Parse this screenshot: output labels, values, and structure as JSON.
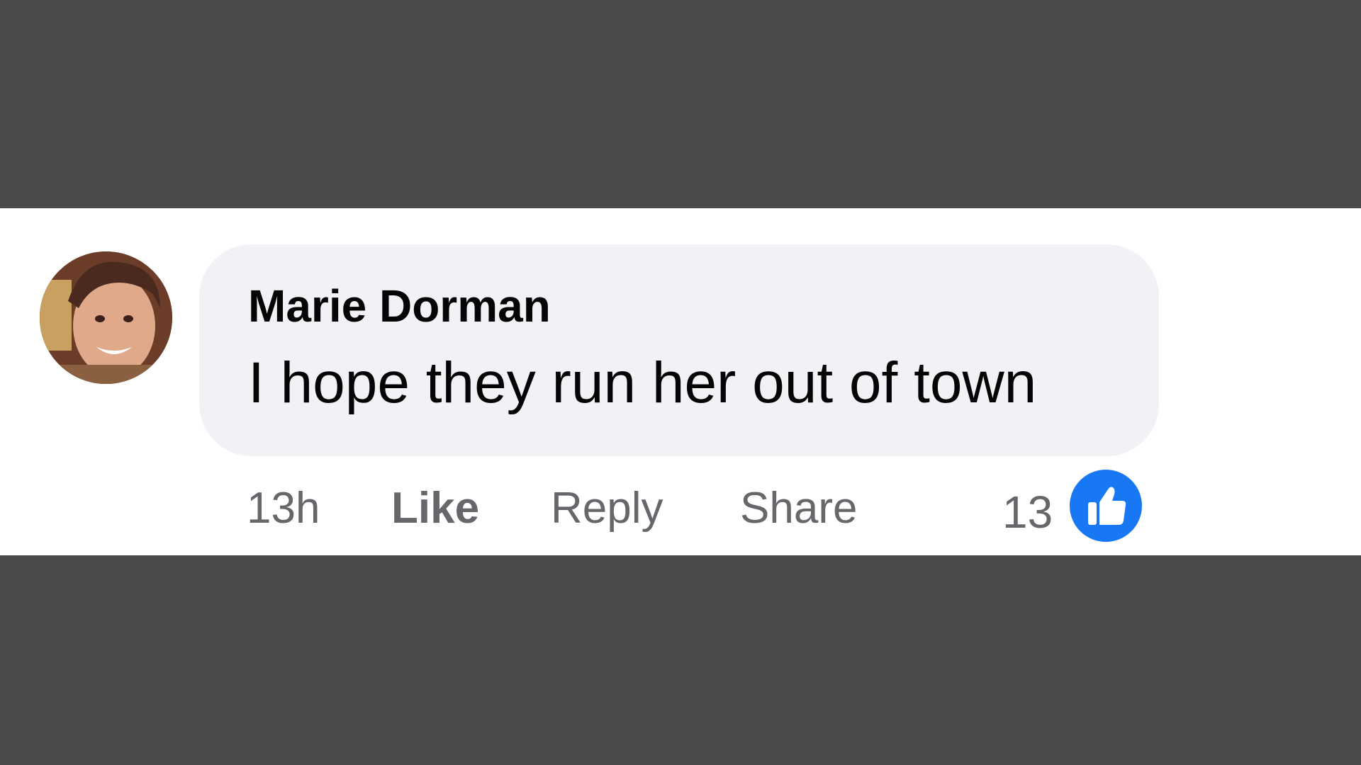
{
  "comment": {
    "author": "Marie Dorman",
    "text": "I hope they run her out of town",
    "timestamp": "13h",
    "actions": {
      "like": "Like",
      "reply": "Reply",
      "share": "Share"
    },
    "reactions": {
      "count": "13",
      "icon": "thumbs-up-icon",
      "color": "#1877f2"
    }
  }
}
